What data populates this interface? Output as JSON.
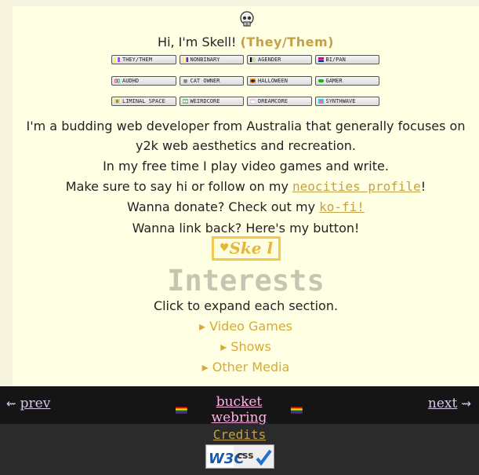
{
  "intro": {
    "greeting": "Hi, I'm Skell! ",
    "pronouns": "(They/Them)"
  },
  "badges": {
    "row1": [
      "THEY/THEM",
      "NONBINARY",
      "AGENDER",
      "BI/PAN"
    ],
    "row2": [
      "AUDHD",
      "CAT OWNER",
      "HALLOWEEN",
      "GAMER"
    ],
    "row3": [
      "LIMINAL SPACE",
      "WEIRDCORE",
      "DREAMCORE",
      "SYNTHWAVE"
    ]
  },
  "bio": {
    "line1": "I'm a budding web developer from Australia that generally focuses on y2k web aesthetics and recreation.",
    "line2": "In my free time I play video games and write.",
    "line3_pre": "Make sure to say hi or follow on my ",
    "line3_link": "neocities profile",
    "line3_post": "!",
    "line4_pre": "Wanna donate? Check out my ",
    "line4_link": "ko-fi!",
    "line5": "Wanna link back? Here's my button!",
    "button_text": "Ske l"
  },
  "interests": {
    "heading": "Interests",
    "hint": "Click to expand each section.",
    "sections": [
      "▸ Video Games",
      "▸ Shows",
      "▸ Other Media"
    ]
  },
  "webring": {
    "prev": "prev",
    "prev_arrow": "⇜",
    "name": "bucket webring",
    "next": "next",
    "next_arrow": "⇝"
  },
  "footer": {
    "credits": "Credits",
    "w3c_label": "css"
  }
}
